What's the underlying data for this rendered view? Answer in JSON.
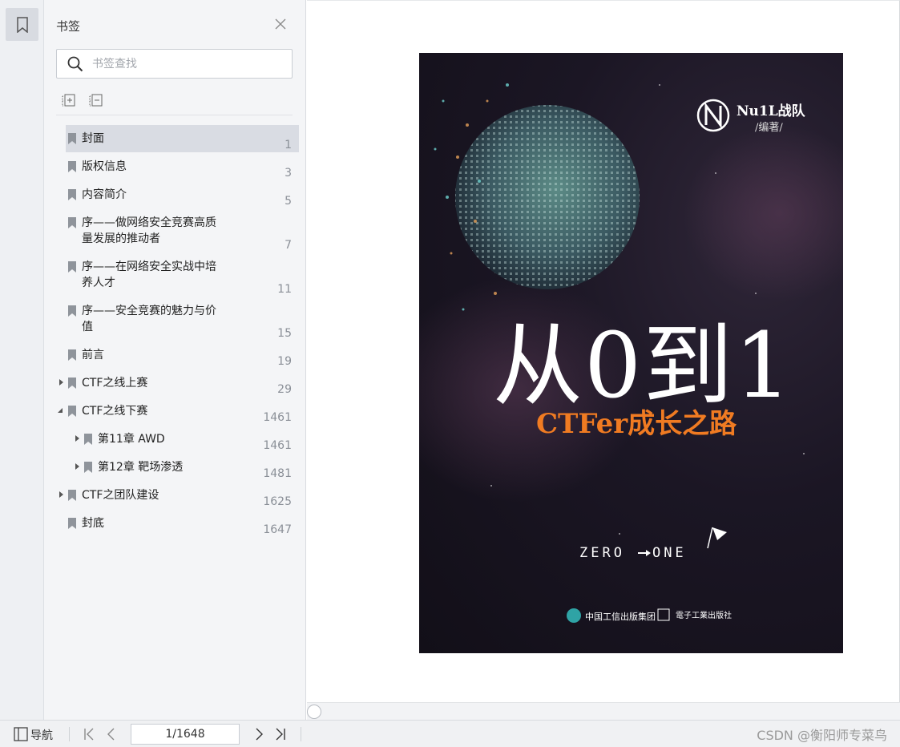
{
  "panel": {
    "title": "书签",
    "search_placeholder": "书签查找"
  },
  "bookmarks": [
    {
      "label": "封面",
      "page": "1",
      "selected": true
    },
    {
      "label": "版权信息",
      "page": "3"
    },
    {
      "label": "内容简介",
      "page": "5"
    },
    {
      "label": "序——做网络安全竞赛高质",
      "label2": "量发展的推动者",
      "page": "7"
    },
    {
      "label": "序——在网络安全实战中培",
      "label2": "养人才",
      "page": "11"
    },
    {
      "label": "序——安全竞赛的魅力与价",
      "label2": "值",
      "page": "15"
    },
    {
      "label": "前言",
      "page": "19"
    },
    {
      "label": "CTF之线上赛",
      "page": "29",
      "arrow": "collapsed"
    },
    {
      "label": "CTF之线下赛",
      "page": "1461",
      "arrow": "expanded"
    },
    {
      "label": "第11章 AWD",
      "page": "1461",
      "arrow": "collapsed",
      "level": 2
    },
    {
      "label": "第12章 靶场渗透",
      "page": "1481",
      "arrow": "collapsed",
      "level": 2
    },
    {
      "label": "CTF之团队建设",
      "page": "1625",
      "arrow": "collapsed"
    },
    {
      "label": "封底",
      "page": "1647"
    }
  ],
  "cover": {
    "author": "Nu1L战队",
    "author_role": "/编著/",
    "title": "从0到1",
    "subtitle": "CTFer成长之路",
    "slogan_left": "ZERO",
    "slogan_right": "ONE",
    "publisher": "中国工信出版集团",
    "publisher2": "電子工業出版社"
  },
  "statusbar": {
    "nav_label": "导航",
    "page_value": "1/1648",
    "watermark": "CSDN @衡阳师专菜鸟"
  },
  "colors": {
    "accent_orange": "#f07b22",
    "selected_bg": "#d9dce3",
    "panel_bg": "#f4f5f7"
  }
}
